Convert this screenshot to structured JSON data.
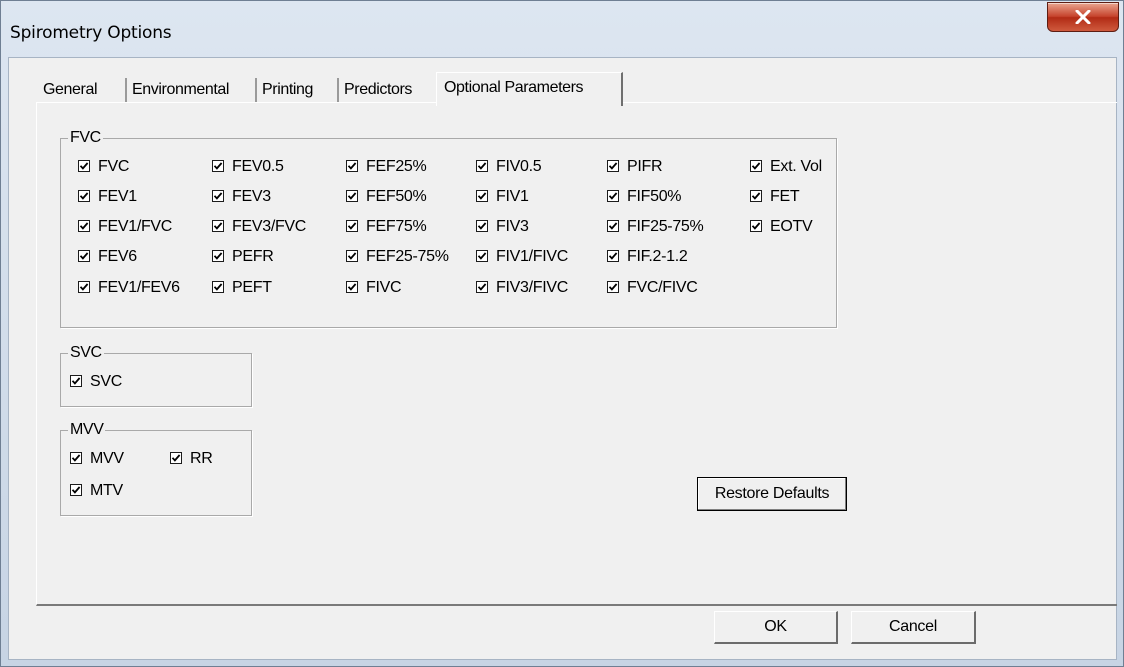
{
  "window": {
    "title": "Spirometry Options",
    "close_icon": "close-icon"
  },
  "tabs": [
    {
      "label": "General",
      "active": false
    },
    {
      "label": "Environmental",
      "active": false
    },
    {
      "label": "Printing",
      "active": false
    },
    {
      "label": "Predictors",
      "active": false
    },
    {
      "label": "Optional Parameters",
      "active": true
    }
  ],
  "groups": {
    "fvc": {
      "legend": "FVC",
      "columns": [
        [
          {
            "label": "FVC",
            "checked": true
          },
          {
            "label": "FEV1",
            "checked": true
          },
          {
            "label": "FEV1/FVC",
            "checked": true
          },
          {
            "label": "FEV6",
            "checked": true
          },
          {
            "label": "FEV1/FEV6",
            "checked": true
          }
        ],
        [
          {
            "label": "FEV0.5",
            "checked": true
          },
          {
            "label": "FEV3",
            "checked": true
          },
          {
            "label": "FEV3/FVC",
            "checked": true
          },
          {
            "label": "PEFR",
            "checked": true
          },
          {
            "label": "PEFT",
            "checked": true
          }
        ],
        [
          {
            "label": "FEF25%",
            "checked": true
          },
          {
            "label": "FEF50%",
            "checked": true
          },
          {
            "label": "FEF75%",
            "checked": true
          },
          {
            "label": "FEF25-75%",
            "checked": true
          },
          {
            "label": "FIVC",
            "checked": true
          }
        ],
        [
          {
            "label": "FIV0.5",
            "checked": true
          },
          {
            "label": "FIV1",
            "checked": true
          },
          {
            "label": "FIV3",
            "checked": true
          },
          {
            "label": "FIV1/FIVC",
            "checked": true
          },
          {
            "label": "FIV3/FIVC",
            "checked": true
          }
        ],
        [
          {
            "label": "PIFR",
            "checked": true
          },
          {
            "label": "FIF50%",
            "checked": true
          },
          {
            "label": "FIF25-75%",
            "checked": true
          },
          {
            "label": "FIF.2-1.2",
            "checked": true
          },
          {
            "label": "FVC/FIVC",
            "checked": true
          }
        ],
        [
          {
            "label": "Ext. Vol",
            "checked": true
          },
          {
            "label": "FET",
            "checked": true
          },
          {
            "label": "EOTV",
            "checked": true
          }
        ]
      ]
    },
    "svc": {
      "legend": "SVC",
      "items": [
        {
          "label": "SVC",
          "checked": true
        }
      ]
    },
    "mvv": {
      "legend": "MVV",
      "items": [
        {
          "label": "MVV",
          "checked": true
        },
        {
          "label": "RR",
          "checked": true
        },
        {
          "label": "MTV",
          "checked": true
        }
      ]
    }
  },
  "buttons": {
    "restore_defaults": "Restore Defaults",
    "ok": "OK",
    "cancel": "Cancel"
  },
  "colors": {
    "close_button": "#c6432c",
    "dialog_face": "#f0f0f0"
  }
}
